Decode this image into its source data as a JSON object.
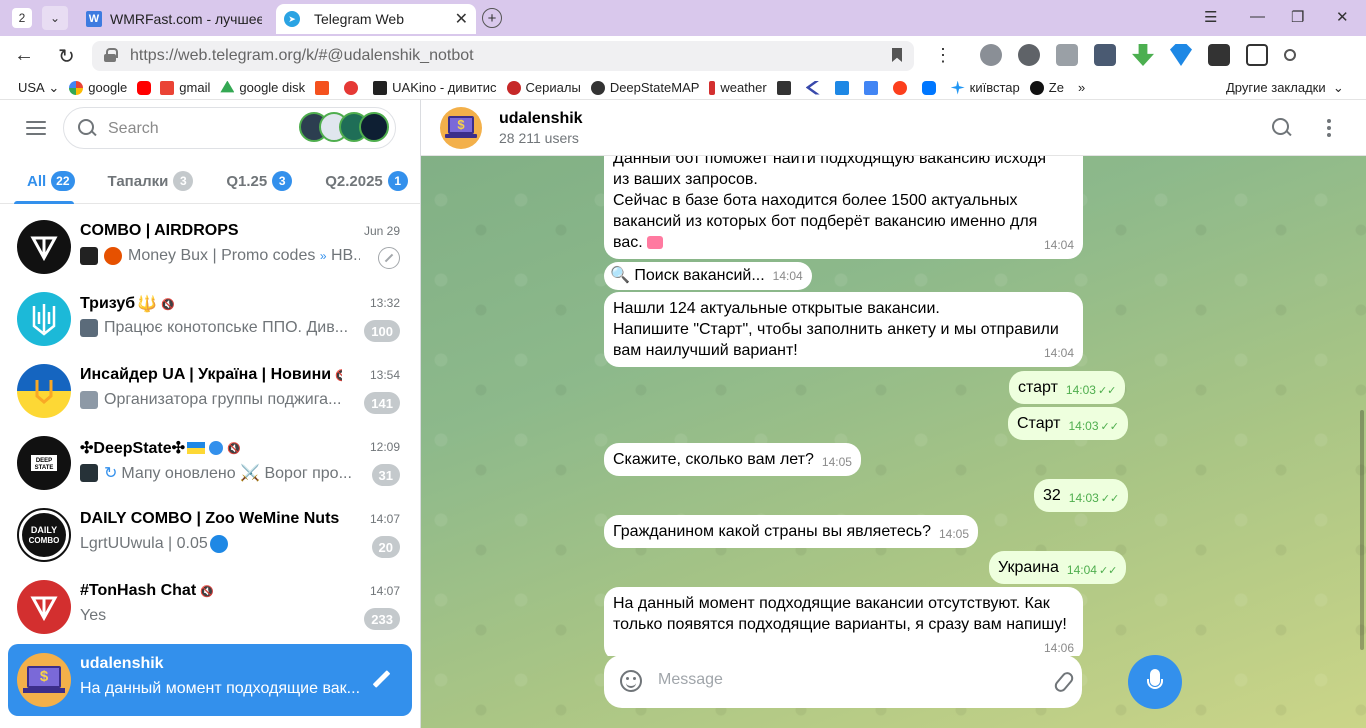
{
  "browser": {
    "tab_count": "2",
    "tabs": [
      {
        "title": "WMRFast.com - лучшее м",
        "favicon": "W"
      },
      {
        "title": "Telegram Web"
      }
    ],
    "url": "https://web.telegram.org/k/#@udalenshik_notbot",
    "bookmarks": [
      "USA",
      "google",
      "gmail",
      "google disk",
      "UAKino - дивитис",
      "Сериалы",
      "DeepStateMAP",
      "weather",
      "київстар",
      "Ze",
      "Другие закладки"
    ],
    "other_bookmarks_label": "Другие закладки"
  },
  "sidebar": {
    "search_placeholder": "Search",
    "folders": [
      {
        "label": "All",
        "count": "22"
      },
      {
        "label": "Тапалки",
        "count": "3"
      },
      {
        "label": "Q1.25",
        "count": "3"
      },
      {
        "label": "Q2.2025",
        "count": "1"
      }
    ],
    "chats": [
      {
        "name": "COMBO | AIRDROPS",
        "time": "Jun 29",
        "preview": "Money Bux | Promo codes",
        "preview2": "НВ...",
        "badge": ""
      },
      {
        "name": "Тризуб",
        "emoji": "🔱",
        "time": "13:32",
        "preview": "Працює конотопське ППО. Див...",
        "badge": "100"
      },
      {
        "name": "Инсайдер UA | Україна | Новини",
        "time": "13:54",
        "preview": "Организатора группы поджига...",
        "badge": "141"
      },
      {
        "name": "✣DeepState✣",
        "time": "12:09",
        "preview": "Мапу оновлено ⚔️ Ворог про...",
        "badge": "31"
      },
      {
        "name": "DAILY COMBO | Zoo WeMine Nuts ...",
        "time": "14:07",
        "preview": "LgrtUUwula | 0.05",
        "badge": "20"
      },
      {
        "name": "#TonHash Chat",
        "time": "14:07",
        "preview": "Yes",
        "badge": "233"
      },
      {
        "name": "udalenshik",
        "time": "",
        "preview": "На данный момент подходящие вак...",
        "badge": ""
      }
    ]
  },
  "chat": {
    "title": "udalenshik",
    "subtitle": "28 211 users",
    "composer_placeholder": "Message",
    "messages": [
      {
        "dir": "in",
        "text": "Данный бот поможет найти подходящую вакансию исходя\nиз ваших запросов.\nСейчас в базе бота находится более 1500 актуальных\nвакансий из которых бот подберёт вакансию именно для\nвас.",
        "time": "14:04"
      },
      {
        "dir": "in",
        "text": "🔍 Поиск вакансий...",
        "time": "14:04"
      },
      {
        "dir": "in",
        "text": "Нашли 124 актуальные открытые вакансии.\nНапишите \"Старт\", чтобы заполнить анкету и мы отправили\nвам наилучший вариант!",
        "time": "14:04"
      },
      {
        "dir": "out",
        "text": "старт",
        "time": "14:03"
      },
      {
        "dir": "out",
        "text": "Старт",
        "time": "14:03"
      },
      {
        "dir": "in",
        "text": "Скажите, сколько вам лет?",
        "time": "14:05"
      },
      {
        "dir": "out",
        "text": "32",
        "time": "14:03"
      },
      {
        "dir": "in",
        "text": "Гражданином какой страны вы являетесь?",
        "time": "14:05"
      },
      {
        "dir": "out",
        "text": "Украина",
        "time": "14:04"
      },
      {
        "dir": "in",
        "text": "На данный момент подходящие вакансии отсутствуют. Как\nтолько появятся подходящие варианты, я сразу вам напишу!",
        "time": "14:06"
      }
    ]
  },
  "colors": {
    "accent": "#3390ec",
    "out_bubble": "#eeffde",
    "tabbar": "#d9c8ec"
  }
}
